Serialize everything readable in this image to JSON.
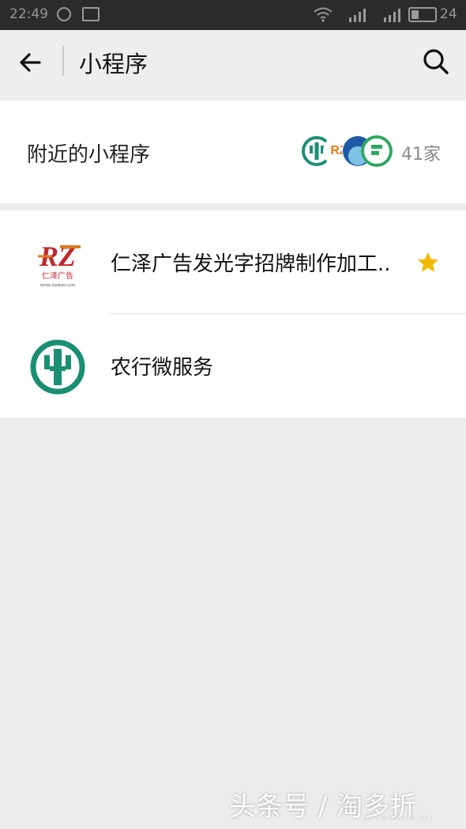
{
  "status_bar": {
    "time": "22:49",
    "battery": "24",
    "network": "4G"
  },
  "header": {
    "title": "小程序",
    "back_icon": "back-arrow-icon",
    "search_icon": "search-icon"
  },
  "nearby": {
    "label": "附近的小程序",
    "count": "41家"
  },
  "mini_programs": [
    {
      "name": "仁泽广告发光字招牌制作加工..",
      "starred": true,
      "icon": "renze-logo-icon",
      "logo_text": "仁泽广告",
      "logo_url": "renze.taobao.com"
    },
    {
      "name": "农行微服务",
      "starred": false,
      "icon": "abc-bank-logo-icon"
    }
  ],
  "colors": {
    "abc_green": "#1a8f72",
    "renze_red": "#c1272d",
    "renze_orange": "#e07a1f",
    "star": "#f5b800"
  },
  "watermark": {
    "text": "头条号 / 淘多折",
    "sub": "XITONGZHIJIA.NET"
  }
}
